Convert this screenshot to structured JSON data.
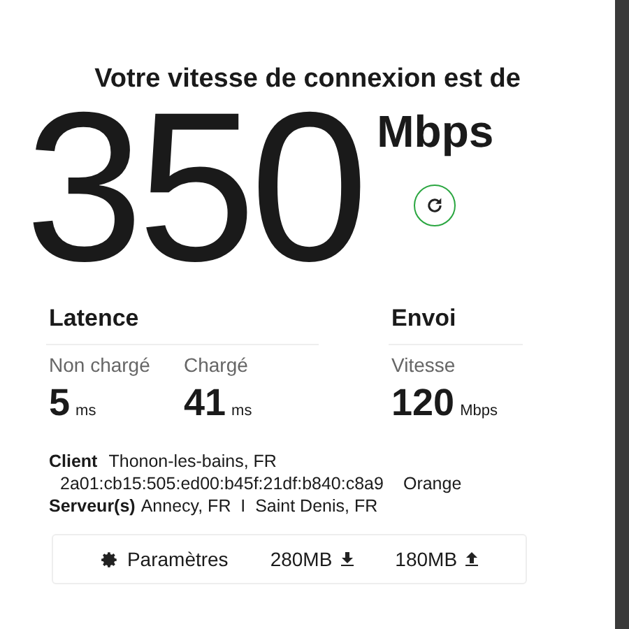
{
  "headline": "Votre vitesse de connexion est de",
  "speed": {
    "value": "350",
    "unit": "Mbps"
  },
  "sections": [
    {
      "title": "Latence",
      "metrics": [
        {
          "label": "Non chargé",
          "value": "5",
          "unit": "ms"
        },
        {
          "label": "Chargé",
          "value": "41",
          "unit": "ms"
        }
      ]
    },
    {
      "title": "Envoi",
      "metrics": [
        {
          "label": "Vitesse",
          "value": "120",
          "unit": "Mbps"
        }
      ]
    }
  ],
  "client": {
    "label": "Client",
    "location": "Thonon-les-bains, FR",
    "address": "2a01:cb15:505:ed00:b45f:21df:b840:c8a9",
    "isp": "Orange"
  },
  "servers": {
    "label": "Serveur(s)",
    "text": "Annecy, FR  I  Saint Denis, FR"
  },
  "footer": {
    "settings": "Paramètres",
    "download": "280MB",
    "upload": "180MB"
  }
}
